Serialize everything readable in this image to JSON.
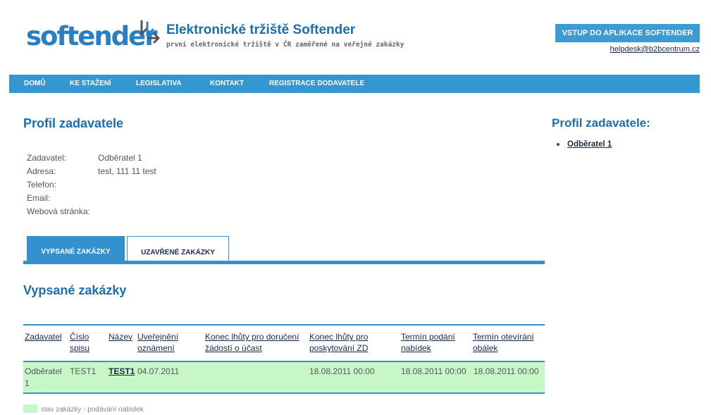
{
  "header": {
    "logo_text": "softender",
    "site_title": "Elektronické tržiště Softender",
    "site_subtitle": "první elektronické tržiště v ČR zaměřené na veřejné zakázky",
    "app_button": "VSTUP DO APLIKACE SOFTENDER",
    "helpdesk_email": "helpdesk@b2bcentrum.cz",
    "brand_color": "#2a7fc4"
  },
  "nav": {
    "items": [
      {
        "label": "DOMŮ"
      },
      {
        "label": "KE STAŽENÍ"
      },
      {
        "label": "LEGISLATIVA"
      },
      {
        "label": "KONTAKT"
      },
      {
        "label": "REGISTRACE DODAVATELE"
      }
    ],
    "color": "#3597d2"
  },
  "main": {
    "title": "Profil zadavatele",
    "info": [
      {
        "label": "Zadavatel:",
        "value": "Odběratel 1"
      },
      {
        "label": "Adresa:",
        "value": "test, 111 11 test"
      },
      {
        "label": "Telefon:",
        "value": ""
      },
      {
        "label": "Email:",
        "value": ""
      },
      {
        "label": "Webová stránka:",
        "value": ""
      }
    ],
    "tabs": [
      {
        "label": "VYPSANÉ ZAKÁZKY",
        "active": true
      },
      {
        "label": "UZAVŘENÉ ZAKÁZKY",
        "active": false
      }
    ],
    "section_title": "Vypsané zakázky",
    "table": {
      "headers": [
        "Zadavatel",
        "Číslo spisu",
        "Název",
        "Uveřejnění oznámení",
        "Konec lhůty pro doručení žádostí o účast",
        "Konec lhůty pro poskytování ZD",
        "Termín podání nabídek",
        "Termín otevírání obálek"
      ],
      "rows": [
        [
          "Odběratel 1",
          "TEST1",
          "TEST1",
          "04.07.2011",
          "",
          "18.08.2011 00:00",
          "18.08.2011 00:00",
          "18.08.2011 00:00"
        ]
      ],
      "row_color": "#c7f7c7"
    },
    "legend": "stav zakázky - podávání nabídek"
  },
  "sidebar": {
    "title": "Profil zadavatele:",
    "items": [
      {
        "label": "Odběratel 1"
      }
    ]
  }
}
